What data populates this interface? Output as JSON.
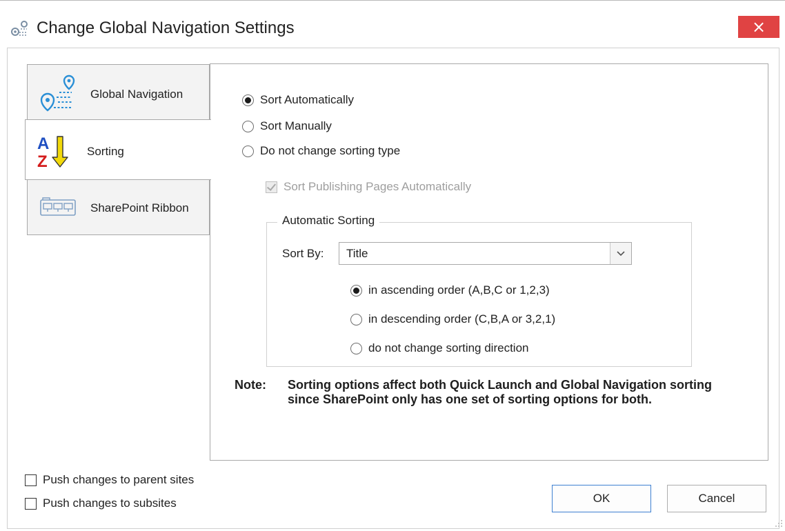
{
  "window": {
    "title": "Change Global Navigation Settings",
    "close_label": "×",
    "title_icon": "navigation-map-pins-icon",
    "close_color": "#e04343"
  },
  "tabs": [
    {
      "label": "Global Navigation",
      "icon": "map-pin-route-icon",
      "selected": false
    },
    {
      "label": "Sorting",
      "icon": "az-sort-arrow-icon",
      "selected": true
    },
    {
      "label": "SharePoint Ribbon",
      "icon": "ribbon-toolbar-icon",
      "selected": false
    }
  ],
  "sorting": {
    "sort_mode_options": [
      {
        "label": "Sort Automatically",
        "checked": true
      },
      {
        "label": "Sort Manually",
        "checked": false
      },
      {
        "label": "Do not change sorting type",
        "checked": false
      }
    ],
    "publishing_pages": {
      "label": "Sort Publishing Pages Automatically",
      "checked": true,
      "disabled": true
    },
    "automatic_sorting": {
      "group_title": "Automatic Sorting",
      "sort_by_label": "Sort By:",
      "sort_by_value": "Title",
      "direction_options": [
        {
          "label": "in ascending order (A,B,C or 1,2,3)",
          "checked": true
        },
        {
          "label": "in descending order (C,B,A or 3,2,1)",
          "checked": false
        },
        {
          "label": "do not change sorting direction",
          "checked": false
        }
      ]
    },
    "note_head": "Note:",
    "note_text": "Sorting options affect both Quick Launch and Global Navigation sorting since SharePoint only has one set of sorting options for both."
  },
  "footer": {
    "push_parent": {
      "label": "Push changes to parent sites",
      "checked": false
    },
    "push_subsites": {
      "label": "Push changes to subsites",
      "checked": false
    },
    "ok_label": "OK",
    "cancel_label": "Cancel"
  },
  "colors": {
    "accent_blue": "#3c7fd1",
    "sort_a_color": "#1f4fc2",
    "sort_z_color": "#d41c1c",
    "sort_arrow_color": "#f2d90a"
  }
}
